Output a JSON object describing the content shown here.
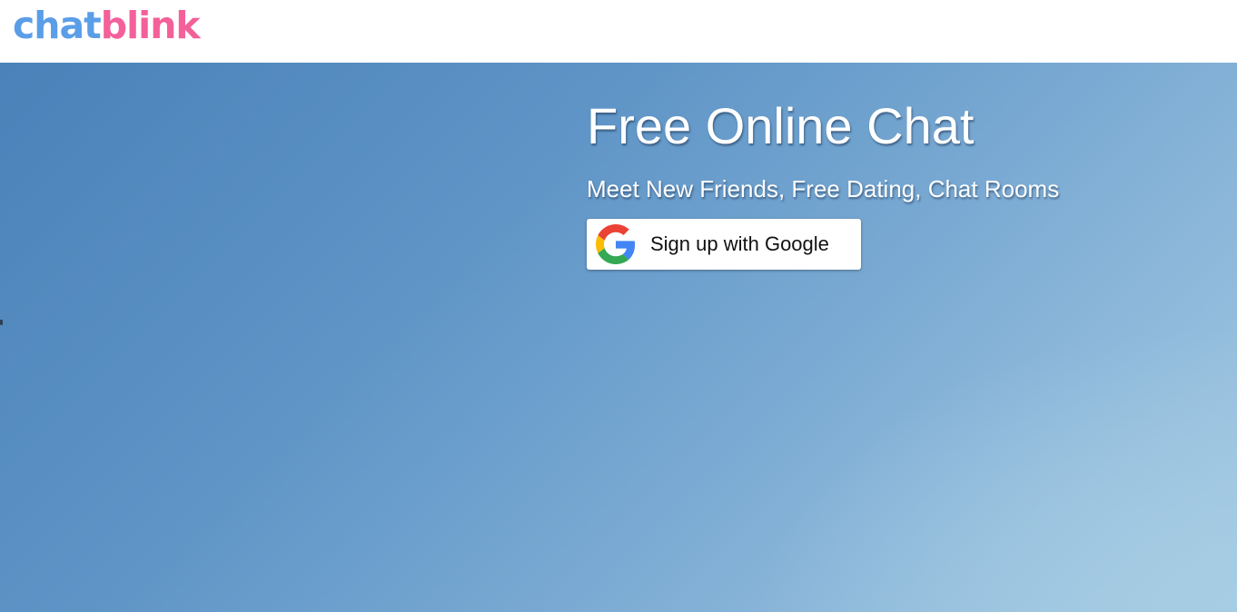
{
  "header": {
    "logo": {
      "part1": "chat",
      "part2": "blink",
      "colors": {
        "part1": "#5b9ee8",
        "part2": "#f4609a"
      }
    }
  },
  "hero": {
    "title": "Free Online Chat",
    "subtitle": "Meet New Friends, Free Dating, Chat Rooms",
    "signup_button": {
      "label": "Sign up with Google",
      "icon": "google-g-icon"
    }
  }
}
